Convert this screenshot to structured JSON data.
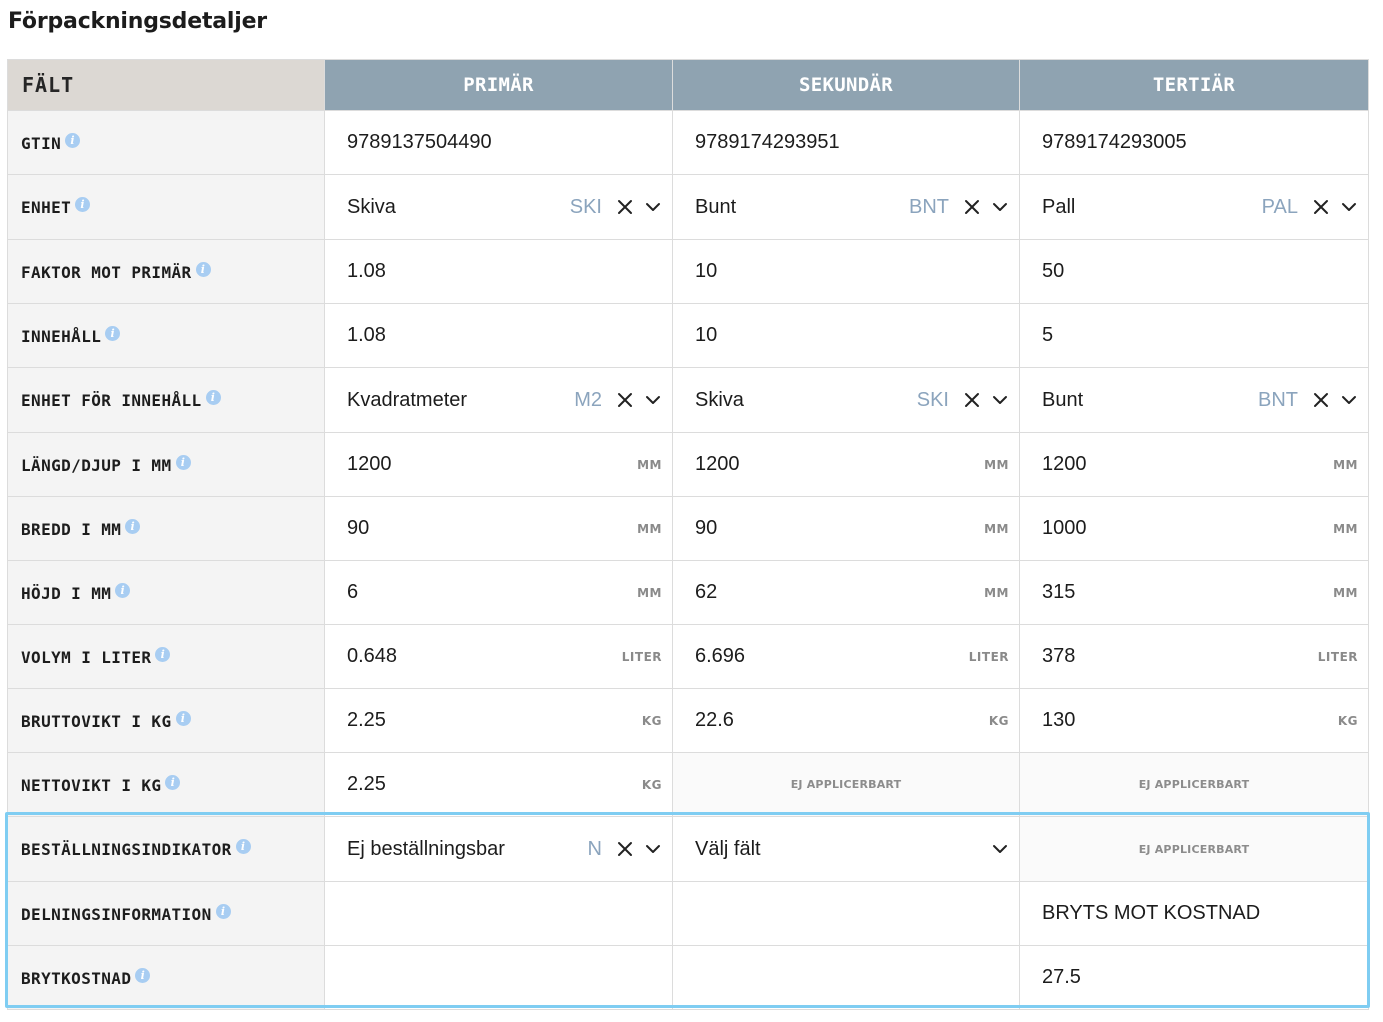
{
  "page": {
    "title": "Förpackningsdetaljer"
  },
  "table": {
    "headers": [
      "FÄLT",
      "PRIMÄR",
      "SEKUNDÄR",
      "TERTIÄR"
    ],
    "rows": [
      {
        "label": "GTIN",
        "cells": [
          {
            "type": "text",
            "value": "9789137504490"
          },
          {
            "type": "text",
            "value": "9789174293951"
          },
          {
            "type": "text",
            "value": "9789174293005"
          }
        ]
      },
      {
        "label": "ENHET",
        "cells": [
          {
            "type": "select",
            "value": "Skiva",
            "code": "SKI"
          },
          {
            "type": "select",
            "value": "Bunt",
            "code": "BNT"
          },
          {
            "type": "select",
            "value": "Pall",
            "code": "PAL"
          }
        ]
      },
      {
        "label": "FAKTOR MOT PRIMÄR",
        "cells": [
          {
            "type": "text",
            "value": "1.08"
          },
          {
            "type": "text",
            "value": "10"
          },
          {
            "type": "text",
            "value": "50"
          }
        ]
      },
      {
        "label": "INNEHÅLL",
        "cells": [
          {
            "type": "text",
            "value": "1.08"
          },
          {
            "type": "text",
            "value": "10"
          },
          {
            "type": "text",
            "value": "5"
          }
        ]
      },
      {
        "label": "ENHET FÖR INNEHÅLL",
        "cells": [
          {
            "type": "select",
            "value": "Kvadratmeter",
            "code": "M2"
          },
          {
            "type": "select",
            "value": "Skiva",
            "code": "SKI"
          },
          {
            "type": "select",
            "value": "Bunt",
            "code": "BNT"
          }
        ]
      },
      {
        "label": "LÄNGD/DJUP I MM",
        "cells": [
          {
            "type": "unit",
            "value": "1200",
            "unit": "MM"
          },
          {
            "type": "unit",
            "value": "1200",
            "unit": "MM"
          },
          {
            "type": "unit",
            "value": "1200",
            "unit": "MM"
          }
        ]
      },
      {
        "label": "BREDD I MM",
        "cells": [
          {
            "type": "unit",
            "value": "90",
            "unit": "MM"
          },
          {
            "type": "unit",
            "value": "90",
            "unit": "MM"
          },
          {
            "type": "unit",
            "value": "1000",
            "unit": "MM"
          }
        ]
      },
      {
        "label": "HÖJD I MM",
        "cells": [
          {
            "type": "unit",
            "value": "6",
            "unit": "MM"
          },
          {
            "type": "unit",
            "value": "62",
            "unit": "MM"
          },
          {
            "type": "unit",
            "value": "315",
            "unit": "MM"
          }
        ]
      },
      {
        "label": "VOLYM I LITER",
        "cells": [
          {
            "type": "unit",
            "value": "0.648",
            "unit": "LITER"
          },
          {
            "type": "unit",
            "value": "6.696",
            "unit": "LITER"
          },
          {
            "type": "unit",
            "value": "378",
            "unit": "LITER"
          }
        ]
      },
      {
        "label": "BRUTTOVIKT I KG",
        "cells": [
          {
            "type": "unit",
            "value": "2.25",
            "unit": "KG"
          },
          {
            "type": "unit",
            "value": "22.6",
            "unit": "KG"
          },
          {
            "type": "unit",
            "value": "130",
            "unit": "KG"
          }
        ]
      },
      {
        "label": "NETTOVIKT I KG",
        "cells": [
          {
            "type": "unit",
            "value": "2.25",
            "unit": "KG"
          },
          {
            "type": "na",
            "value": "EJ APPLICERBART"
          },
          {
            "type": "na",
            "value": "EJ APPLICERBART"
          }
        ]
      },
      {
        "label": "BESTÄLLNINGSINDIKATOR",
        "cells": [
          {
            "type": "select",
            "value": "Ej beställningsbar",
            "code": "N"
          },
          {
            "type": "select-empty",
            "value": "Välj fält"
          },
          {
            "type": "na",
            "value": "EJ APPLICERBART"
          }
        ]
      },
      {
        "label": "DELNINGSINFORMATION",
        "cells": [
          {
            "type": "empty"
          },
          {
            "type": "empty"
          },
          {
            "type": "text",
            "value": "BRYTS MOT KOSTNAD"
          }
        ]
      },
      {
        "label": "BRYTKOSTNAD",
        "cells": [
          {
            "type": "empty"
          },
          {
            "type": "empty"
          },
          {
            "type": "text",
            "value": "27.5"
          }
        ]
      }
    ]
  },
  "icons": {
    "info": "info-icon",
    "clear": "clear-icon",
    "dropdown": "chevron-down-icon"
  },
  "colors": {
    "header": "#8fa3b1",
    "field_header": "#dcd8d3",
    "info": "#a8cdf2",
    "highlight": "#7fcdf2",
    "code": "#8ba4bd"
  }
}
